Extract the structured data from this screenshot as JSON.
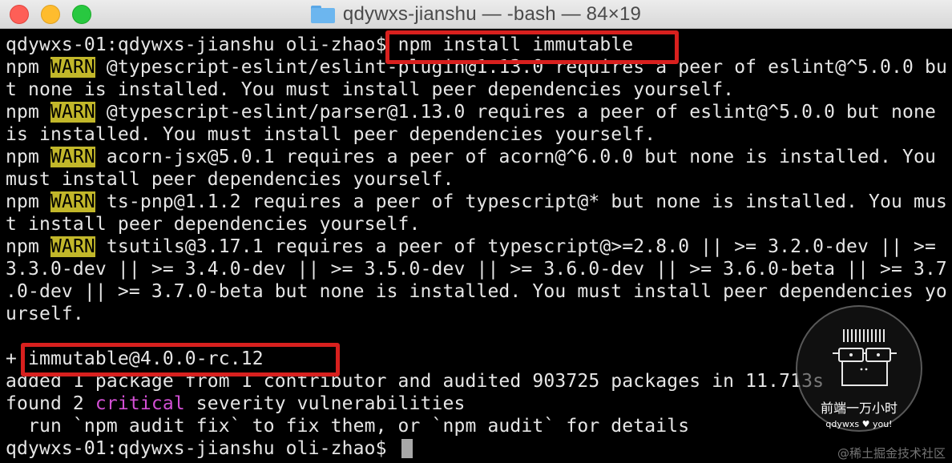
{
  "window": {
    "title": "qdywxs-jianshu — -bash — 84×19"
  },
  "terminal": {
    "prompt_cmd": {
      "prompt": "qdywxs-01:qdywxs-jianshu oli-zhao$ ",
      "command": "npm install immutable"
    },
    "warn_label": "WARN",
    "npm_label": "npm",
    "warnings": [
      {
        "first": " @typescript-eslint/eslint-plugin@1.13.0 requires a peer of eslint@^5.0.0 bu",
        "rest": [
          "t none is installed. You must install peer dependencies yourself."
        ]
      },
      {
        "first": " @typescript-eslint/parser@1.13.0 requires a peer of eslint@^5.0.0 but none",
        "rest": [
          "is installed. You must install peer dependencies yourself."
        ]
      },
      {
        "first": " acorn-jsx@5.0.1 requires a peer of acorn@^6.0.0 but none is installed. You",
        "rest": [
          "must install peer dependencies yourself."
        ]
      },
      {
        "first": " ts-pnp@1.1.2 requires a peer of typescript@* but none is installed. You mus",
        "rest": [
          "t install peer dependencies yourself."
        ]
      },
      {
        "first": " tsutils@3.17.1 requires a peer of typescript@>=2.8.0 || >= 3.2.0-dev || >=",
        "rest": [
          "3.3.0-dev || >= 3.4.0-dev || >= 3.5.0-dev || >= 3.6.0-dev || >= 3.6.0-beta || >= 3.7",
          ".0-dev || >= 3.7.0-beta but none is installed. You must install peer dependencies yo",
          "urself."
        ]
      }
    ],
    "installed": {
      "prefix": "+ ",
      "package": "immutable@4.0.0-rc.12"
    },
    "added_line": "added 1 package from 1 contributor and audited 903725 packages in 11.713s",
    "found": {
      "before": "found 2 ",
      "critical": "critical",
      "after": " severity vulnerabilities"
    },
    "run_line": "  run `npm audit fix` to fix them, or `npm audit` for details",
    "final_prompt": "qdywxs-01:qdywxs-jianshu oli-zhao$ "
  },
  "watermark": {
    "brand": "前端一万小时",
    "tagline": "qdywxs ♥ you!",
    "face_icon": "robot-face-icon"
  },
  "footer": {
    "brand": "@稀土掘金技术社区"
  },
  "colors": {
    "warn_bg": "#c2b72a",
    "critical_text": "#d34fd4",
    "highlight_box": "#d8201e"
  }
}
